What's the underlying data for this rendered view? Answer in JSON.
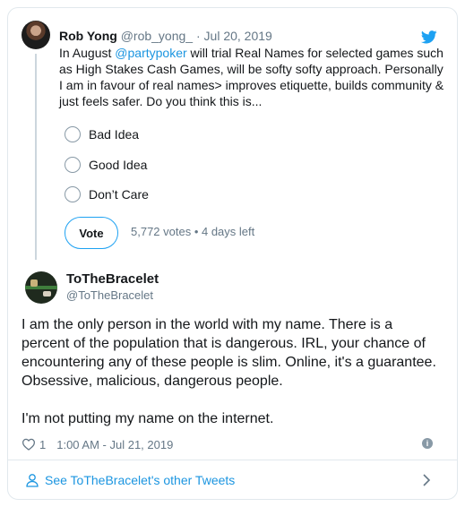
{
  "parent_tweet": {
    "name": "Rob Yong",
    "handle": "@rob_yong_",
    "dot": "·",
    "date": "Jul 20, 2019",
    "text_before": "In August ",
    "mention": "@partypoker",
    "text_after": " will trial Real Names for selected games such as High Stakes Cash Games, will be softy softy approach. Personally I am in favour of real names> improves etiquette, builds community & just feels safer. Do you think this is..."
  },
  "poll": {
    "options": [
      "Bad Idea",
      "Good Idea",
      "Don’t Care"
    ],
    "vote_label": "Vote",
    "meta": "5,772 votes • 4 days left"
  },
  "tweet": {
    "name": "ToTheBracelet",
    "handle": "@ToTheBracelet",
    "text": "I am the only person in the world with my name. There is a percent of the population that is dangerous. IRL, your chance of encountering any of these people is slim. Online, it's a guarantee. Obsessive, malicious, dangerous people.\n\nI'm not putting my name on the internet.",
    "like_count": "1",
    "timestamp": "1:00 AM - Jul 21, 2019",
    "info_glyph": "i"
  },
  "footer": {
    "link_label": "See ToTheBracelet's other Tweets"
  },
  "icons": {
    "bird": "twitter-bird-icon",
    "heart": "heart-icon",
    "info": "info-icon",
    "person": "person-icon",
    "chevron": "chevron-right-icon"
  },
  "colors": {
    "accent": "#1da1f2",
    "link": "#1b95e0",
    "secondary_text": "#657786",
    "border": "#e1e8ed"
  }
}
